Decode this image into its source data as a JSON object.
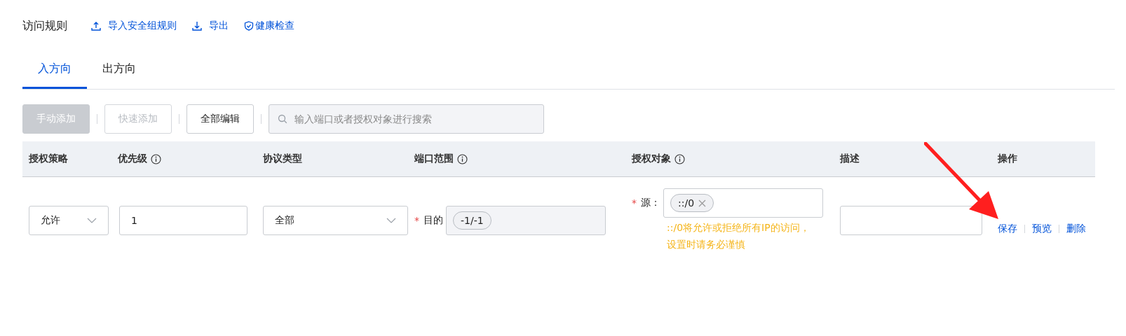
{
  "header": {
    "title": "访问规则",
    "actions": [
      {
        "kind": "upload",
        "label": "导入安全组规则"
      },
      {
        "kind": "download",
        "label": "导出"
      },
      {
        "kind": "shield",
        "label": "健康检查"
      }
    ]
  },
  "tabs": [
    {
      "label": "入方向",
      "selected": true
    },
    {
      "label": "出方向",
      "selected": false
    }
  ],
  "toolbar": {
    "buttons": [
      {
        "label": "手动添加",
        "kind": "primary",
        "disabled": true
      },
      {
        "label": "快速添加",
        "kind": "default",
        "disabled": true
      },
      {
        "label": "全部编辑",
        "kind": "default",
        "disabled": false
      }
    ],
    "search": {
      "placeholder": "输入端口或者授权对象进行搜索"
    }
  },
  "table": {
    "columns": [
      {
        "label": "授权策略",
        "info": false
      },
      {
        "label": "优先级",
        "info": true
      },
      {
        "label": "协议类型",
        "info": false
      },
      {
        "label": "端口范围",
        "info": true
      },
      {
        "label": "授权对象",
        "info": true
      },
      {
        "label": "描述",
        "info": false
      },
      {
        "label": "操作",
        "info": false
      }
    ],
    "rows": [
      {
        "policy": "允许",
        "priority": "1",
        "protocol": "全部",
        "port": {
          "label": "目的",
          "required_mark": "*",
          "disabled": true,
          "tags": [
            {
              "text": "-1/-1",
              "removable": false
            }
          ]
        },
        "source": {
          "label": "源：",
          "required_mark": "*",
          "disabled": false,
          "tags": [
            {
              "text": "::/0",
              "removable": true
            }
          ],
          "hint": "::/0将允许或拒绝所有IP的访问，设置时请务必谨慎"
        },
        "actions": [
          "保存",
          "预览",
          "删除"
        ]
      }
    ]
  },
  "annotations": [
    {
      "kind": "arrow",
      "color": "#ff1f1f"
    }
  ]
}
